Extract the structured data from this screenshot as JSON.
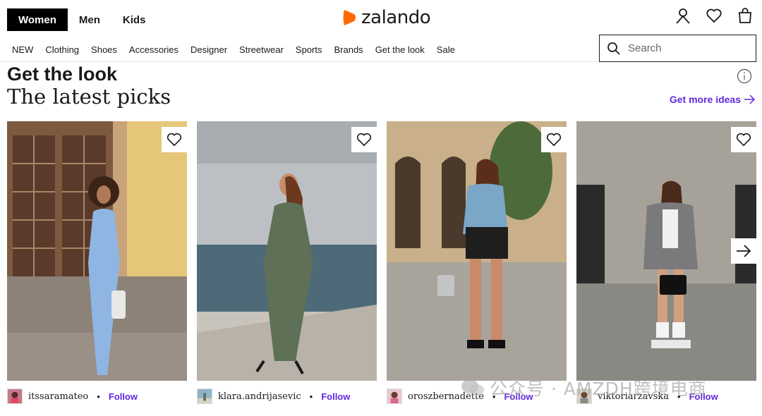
{
  "header": {
    "gender_tabs": [
      {
        "label": "Women",
        "active": true
      },
      {
        "label": "Men",
        "active": false
      },
      {
        "label": "Kids",
        "active": false
      }
    ],
    "logo_text": "zalando",
    "brand_color": "#ff6900",
    "icons": [
      "user-icon",
      "heart-icon",
      "bag-icon"
    ]
  },
  "nav": {
    "items": [
      "NEW",
      "Clothing",
      "Shoes",
      "Accessories",
      "Designer",
      "Streetwear",
      "Sports",
      "Brands",
      "Get the look",
      "Sale"
    ]
  },
  "search": {
    "placeholder": "Search"
  },
  "section": {
    "title": "Get the look",
    "subtitle": "The latest picks",
    "more_label": "Get more ideas",
    "accent_color": "#6328e0"
  },
  "cards": [
    {
      "username": "itssaramateo",
      "follow_label": "Follow"
    },
    {
      "username": "klara.andrijasevic",
      "follow_label": "Follow"
    },
    {
      "username": "oroszbernadette",
      "follow_label": "Follow"
    },
    {
      "username": "viktoriarzavska",
      "follow_label": "Follow"
    }
  ],
  "watermark": "公众号 · AMZDH跨境电商"
}
